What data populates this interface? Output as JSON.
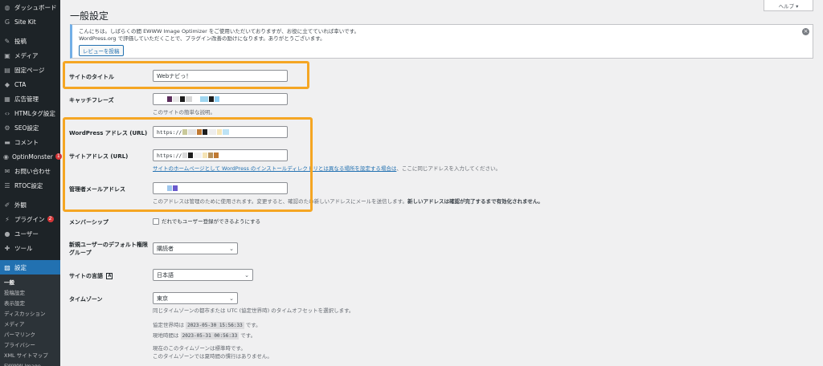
{
  "sidebar": {
    "items": [
      {
        "label": "ダッシュボード",
        "icon": "dashboard-icon",
        "glyph": "◍"
      },
      {
        "label": "Site Kit",
        "icon": "sitekit-icon",
        "glyph": "G"
      },
      {
        "label": "投稿",
        "icon": "pin-icon",
        "glyph": "✎"
      },
      {
        "label": "メディア",
        "icon": "media-icon",
        "glyph": "▣"
      },
      {
        "label": "固定ページ",
        "icon": "page-icon",
        "glyph": "▤"
      },
      {
        "label": "CTA",
        "icon": "cta-icon",
        "glyph": "◆"
      },
      {
        "label": "広告管理",
        "icon": "ads-icon",
        "glyph": "▦"
      },
      {
        "label": "HTMLタグ設定",
        "icon": "code-icon",
        "glyph": "‹›"
      },
      {
        "label": "SEO設定",
        "icon": "seo-icon",
        "glyph": "⚙"
      },
      {
        "label": "コメント",
        "icon": "comment-icon",
        "glyph": "▬"
      },
      {
        "label": "OptinMonster",
        "icon": "optinmonster-icon",
        "glyph": "◉",
        "badge": "1"
      },
      {
        "label": "お問い合わせ",
        "icon": "mail-icon",
        "glyph": "✉"
      },
      {
        "label": "RTOC設定",
        "icon": "list-icon",
        "glyph": "☰"
      },
      {
        "label": "外観",
        "icon": "appearance-icon",
        "glyph": "✐"
      },
      {
        "label": "プラグイン",
        "icon": "plugin-icon",
        "glyph": "⚡",
        "badge": "2"
      },
      {
        "label": "ユーザー",
        "icon": "user-icon",
        "glyph": "●"
      },
      {
        "label": "ツール",
        "icon": "tool-icon",
        "glyph": "✚"
      },
      {
        "label": "設定",
        "icon": "settings-icon",
        "glyph": "▨"
      }
    ],
    "submenu": [
      "一般",
      "投稿設定",
      "表示設定",
      "ディスカッション",
      "メディア",
      "パーマリンク",
      "プライバシー",
      "XML サイトマップ",
      "EWWW Image Optimizer"
    ]
  },
  "header": {
    "help": "ヘルプ ▾",
    "title": "一般設定"
  },
  "notice": {
    "line1": "こんにちは。しばらくの間 EWWW Image Optimizer をご使用いただいておりますが、お役に立てていれば幸いです。",
    "line2": "WordPress.org で評価していただくことで、プラグイン改善の励けになります。ありがとうございます。",
    "button": "レビューを投稿",
    "close": "×"
  },
  "form": {
    "site_title": {
      "label": "サイトのタイトル",
      "value": "Webナビっ！"
    },
    "tagline": {
      "label": "キャッチフレーズ",
      "desc": "このサイトの簡単な説明。"
    },
    "wp_address": {
      "label": "WordPress アドレス (URL)",
      "value": "https://"
    },
    "site_address": {
      "label": "サイトアドレス (URL)",
      "value": "https://",
      "desc_link": "サイトのホームページとして WordPress のインストールディレクトリとは異なる場所を設定する場合は",
      "desc_rest": "、ここに同じアドレスを入力してください。"
    },
    "admin_email": {
      "label": "管理者メールアドレス",
      "desc": "このアドレスは管理のために使用されます。変更すると、確認のため新しいアドレスにメールを送信します。",
      "desc_bold": "新しいアドレスは確認が完了するまで有効化されません。"
    },
    "membership": {
      "label": "メンバーシップ",
      "checkbox": "だれでもユーザー登録ができるようにする"
    },
    "default_role": {
      "label": "新規ユーザーのデフォルト権限グループ",
      "value": "購読者"
    },
    "language": {
      "label": "サイトの言語",
      "value": "日本語"
    },
    "timezone": {
      "label": "タイムゾーン",
      "value": "東京",
      "desc": "同じタイムゾーンの都市または UTC (協定世界時) のタイムオフセットを選択します。",
      "utc_label": "協定世界時は",
      "utc_value": "2023-05-30 15:56:33",
      "utc_suffix": "です。",
      "local_label": "現地時間は",
      "local_value": "2023-05-31 00:56:33",
      "local_suffix": "です。",
      "note1": "現在のこのタイムゾーンは標準時です。",
      "note2": "このタイムゾーンでは夏時間の慣行はありません。"
    }
  },
  "colors": {
    "sidebar_bg": "#1d2327",
    "active": "#2271b1",
    "highlight": "#f5a623"
  }
}
